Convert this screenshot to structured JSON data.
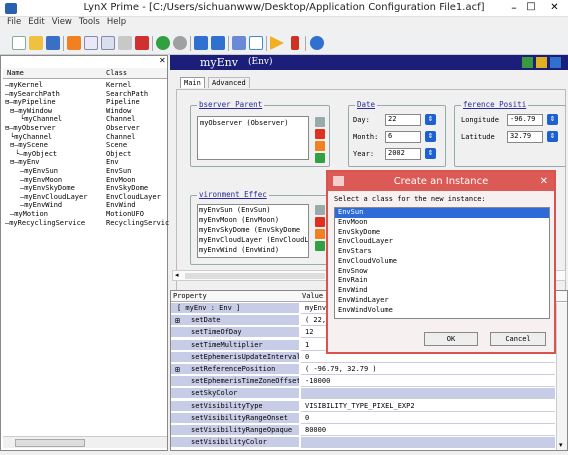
{
  "window": {
    "title": "LynX Prime - [C:/Users/sichuanwww/Desktop/Application Configuration File1.acf]",
    "min": "–",
    "max": "□",
    "close": "✕"
  },
  "menu": [
    "File",
    "Edit",
    "View",
    "Tools",
    "Help"
  ],
  "toolbar": {
    "icons": [
      "new-icon",
      "open-icon",
      "save-icon",
      "stop-icon",
      "cut-icon",
      "copy-icon",
      "paste-icon",
      "delete-icon",
      "back-icon",
      "forward-icon",
      "undo-icon",
      "redo-icon",
      "grid-icon",
      "info-icon",
      "play-icon",
      "script-icon",
      "help-icon"
    ]
  },
  "tree": {
    "col_name": "Name",
    "col_class": "Class",
    "rows": [
      {
        "name": "—myKernel",
        "cls": "Kernel",
        "indent": 0
      },
      {
        "name": "—mySearchPath",
        "cls": "SearchPath",
        "indent": 0
      },
      {
        "name": "⊟—myPipeline",
        "cls": "Pipeline",
        "indent": 0
      },
      {
        "name": "⊟—myWindow",
        "cls": "Window",
        "indent": 1
      },
      {
        "name": "└myChannel",
        "cls": "Channel",
        "indent": 3
      },
      {
        "name": "⊟—myObserver",
        "cls": "Observer",
        "indent": 0
      },
      {
        "name": "└myChannel",
        "cls": "Channel",
        "indent": 1
      },
      {
        "name": "⊟—myScene",
        "cls": "Scene",
        "indent": 1
      },
      {
        "name": "└—myObject",
        "cls": "Object",
        "indent": 2
      },
      {
        "name": "⊟—myEnv",
        "cls": "Env",
        "indent": 1
      },
      {
        "name": "—myEnvSun",
        "cls": "EnvSun",
        "indent": 3
      },
      {
        "name": "—myEnvMoon",
        "cls": "EnvMoon",
        "indent": 3
      },
      {
        "name": "—myEnvSkyDome",
        "cls": "EnvSkyDome",
        "indent": 3
      },
      {
        "name": "—myEnvCloudLayer",
        "cls": "EnvCloudLayer",
        "indent": 3
      },
      {
        "name": "—myEnvWind",
        "cls": "EnvWind",
        "indent": 3
      },
      {
        "name": "—myMotion",
        "cls": "MotionUFO",
        "indent": 1
      },
      {
        "name": "—myRecyclingService",
        "cls": "RecyclingServic",
        "indent": 0
      }
    ]
  },
  "panel": {
    "title": "myEnv",
    "subtitle": "(Env)",
    "tabs": [
      "Main",
      "Advanced"
    ],
    "observer": {
      "label": "bserver Parent",
      "value": "myObserver (Observer)"
    },
    "date": {
      "label": "Date",
      "day_label": "Day:",
      "day": "22",
      "month_label": "Month:",
      "month": "6",
      "year_label": "Year:",
      "year": "2002"
    },
    "ref": {
      "label": "ference Positi",
      "lon_label": "Longitude",
      "lon": "-96.79",
      "lat_label": "Latitude",
      "lat": "32.79"
    },
    "env": {
      "label": "vironment Effec",
      "items": [
        "myEnvSun (EnvSun)",
        "myEnvMoon (EnvMoon)",
        "myEnvSkyDome (EnvSkyDome",
        "myEnvCloudLayer (EnvCloudL",
        "myEnvWind (EnvWind)"
      ]
    }
  },
  "props": {
    "col_prop": "Property",
    "col_value": "Value",
    "rows": [
      {
        "n": "[ myEnv : Env ]",
        "v": "myEnv",
        "exp": false
      },
      {
        "n": "setDate",
        "v": "( 22,",
        "exp": true
      },
      {
        "n": "setTimeOfDay",
        "v": "12",
        "exp": false
      },
      {
        "n": "setTimeMultiplier",
        "v": "1",
        "exp": false
      },
      {
        "n": "setEphemerisUpdateInterval",
        "v": "0",
        "exp": false
      },
      {
        "n": "setReferencePosition",
        "v": "( -96.79, 32.79 )",
        "exp": true
      },
      {
        "n": "setEphemerisTimeZoneOffset",
        "v": "-10000",
        "exp": false
      },
      {
        "n": "setSkyColor",
        "v": "",
        "exp": false
      },
      {
        "n": "setVisibilityType",
        "v": "VISIBILITY_TYPE_PIXEL_EXP2",
        "exp": false
      },
      {
        "n": "setVisibilityRangeOnset",
        "v": "0",
        "exp": false
      },
      {
        "n": "setVisibilityRangeOpaque",
        "v": "80000",
        "exp": false
      },
      {
        "n": "setVisibilityColor",
        "v": "",
        "exp": false
      }
    ]
  },
  "dialog": {
    "title": "Create an Instance",
    "prompt": "Select a class for the new instance:",
    "classes": [
      "EnvSun",
      "EnvMoon",
      "EnvSkyDome",
      "EnvCloudLayer",
      "EnvStars",
      "EnvCloudVolume",
      "EnvSnow",
      "EnvRain",
      "EnvWind",
      "EnvWindLayer",
      "EnvWindVolume"
    ],
    "selected": 0,
    "ok": "OK",
    "cancel": "Cancel"
  }
}
